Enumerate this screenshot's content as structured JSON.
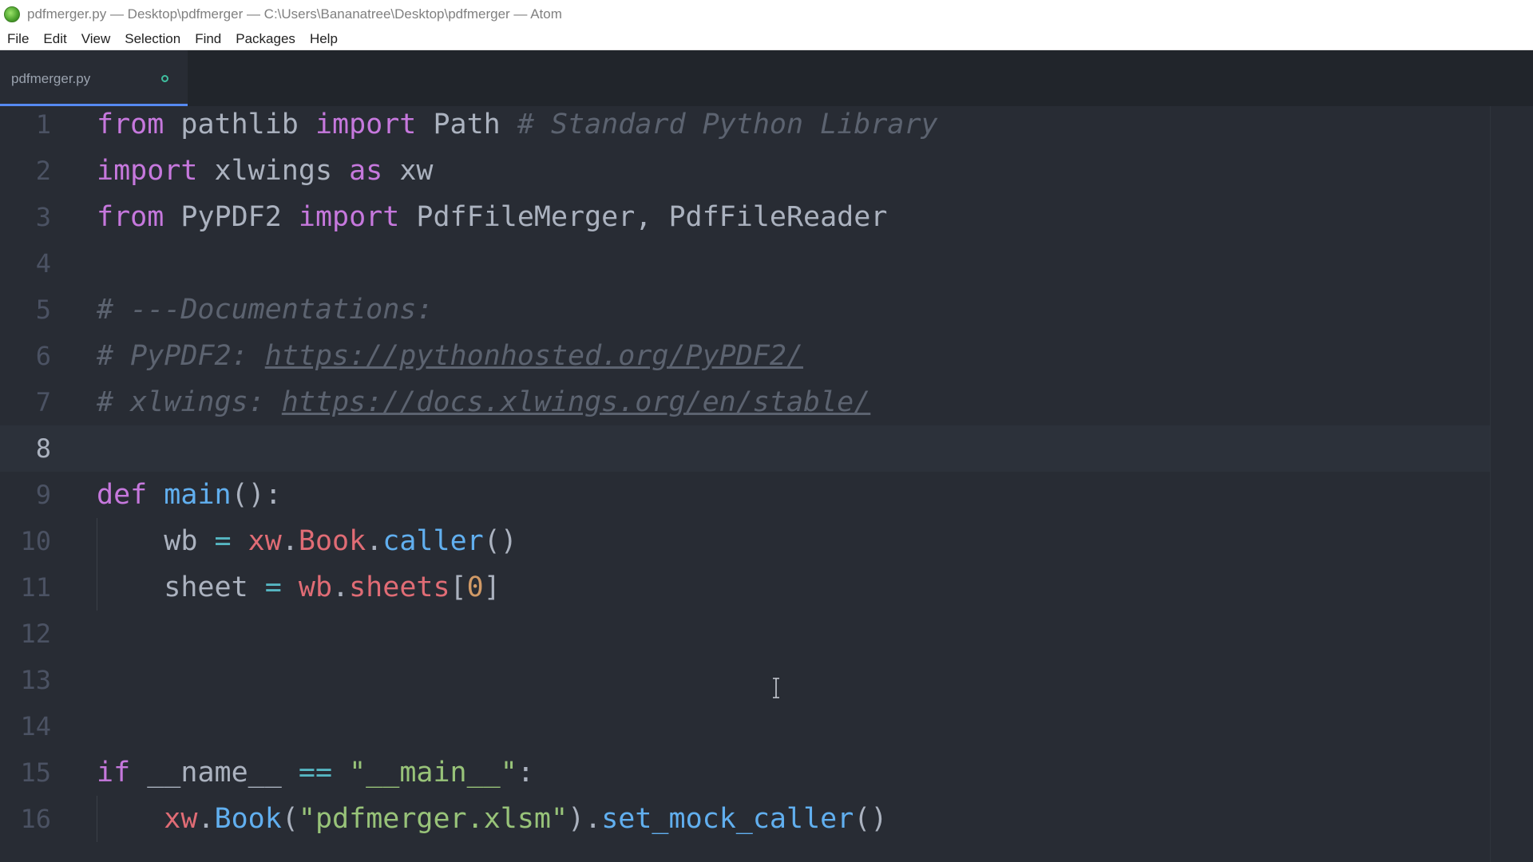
{
  "window": {
    "title": "pdfmerger.py — Desktop\\pdfmerger — C:\\Users\\Bananatree\\Desktop\\pdfmerger — Atom",
    "icon": "atom-app-icon"
  },
  "menu": {
    "items": [
      "File",
      "Edit",
      "View",
      "Selection",
      "Find",
      "Packages",
      "Help"
    ]
  },
  "tabs": [
    {
      "title": "pdfmerger.py",
      "modified": true
    }
  ],
  "editor": {
    "active_line": 8,
    "line_numbers": [
      "1",
      "2",
      "3",
      "4",
      "5",
      "6",
      "7",
      "8",
      "9",
      "10",
      "11",
      "12",
      "13",
      "14",
      "15",
      "16"
    ],
    "lines": [
      [
        {
          "t": "from",
          "c": "kw"
        },
        {
          "t": " pathlib "
        },
        {
          "t": "import",
          "c": "kw"
        },
        {
          "t": " Path "
        },
        {
          "t": "# Standard Python Library",
          "c": "cm"
        }
      ],
      [
        {
          "t": "import",
          "c": "kw"
        },
        {
          "t": " xlwings "
        },
        {
          "t": "as",
          "c": "kw"
        },
        {
          "t": " xw"
        }
      ],
      [
        {
          "t": "from",
          "c": "kw"
        },
        {
          "t": " PyPDF2 "
        },
        {
          "t": "import",
          "c": "kw"
        },
        {
          "t": " PdfFileMerger, PdfFileReader"
        }
      ],
      [],
      [
        {
          "t": "# ---Documentations:",
          "c": "cm"
        }
      ],
      [
        {
          "t": "# PyPDF2: ",
          "c": "cm"
        },
        {
          "t": "https://pythonhosted.org/PyPDF2/",
          "c": "cm link"
        }
      ],
      [
        {
          "t": "# xlwings: ",
          "c": "cm"
        },
        {
          "t": "https://docs.xlwings.org/en/stable/",
          "c": "cm link"
        }
      ],
      [],
      [
        {
          "t": "def",
          "c": "kw"
        },
        {
          "t": " "
        },
        {
          "t": "main",
          "c": "fn"
        },
        {
          "t": "():"
        }
      ],
      [
        {
          "t": "    wb "
        },
        {
          "t": "=",
          "c": "op"
        },
        {
          "t": " "
        },
        {
          "t": "xw",
          "c": "var"
        },
        {
          "t": "."
        },
        {
          "t": "Book",
          "c": "var"
        },
        {
          "t": "."
        },
        {
          "t": "caller",
          "c": "fn"
        },
        {
          "t": "()"
        }
      ],
      [
        {
          "t": "    sheet "
        },
        {
          "t": "=",
          "c": "op"
        },
        {
          "t": " "
        },
        {
          "t": "wb",
          "c": "var"
        },
        {
          "t": "."
        },
        {
          "t": "sheets",
          "c": "var"
        },
        {
          "t": "["
        },
        {
          "t": "0",
          "c": "num"
        },
        {
          "t": "]"
        }
      ],
      [],
      [],
      [],
      [
        {
          "t": "if",
          "c": "kw"
        },
        {
          "t": " __name__ "
        },
        {
          "t": "==",
          "c": "op"
        },
        {
          "t": " "
        },
        {
          "t": "\"__main__\"",
          "c": "str"
        },
        {
          "t": ":"
        }
      ],
      [
        {
          "t": "    "
        },
        {
          "t": "xw",
          "c": "var"
        },
        {
          "t": "."
        },
        {
          "t": "Book",
          "c": "fn"
        },
        {
          "t": "("
        },
        {
          "t": "\"pdfmerger.xlsm\"",
          "c": "str"
        },
        {
          "t": ")."
        },
        {
          "t": "set_mock_caller",
          "c": "fn"
        },
        {
          "t": "()"
        }
      ]
    ]
  },
  "colors": {
    "editor_bg": "#282c34",
    "keyword": "#c678dd",
    "function": "#61afef",
    "variable": "#e06c75",
    "string": "#98c379",
    "number": "#d19a66",
    "operator": "#56b6c2",
    "comment": "#5c6370",
    "tab_accent": "#568af2",
    "modified_dot": "#3fbf9f"
  }
}
